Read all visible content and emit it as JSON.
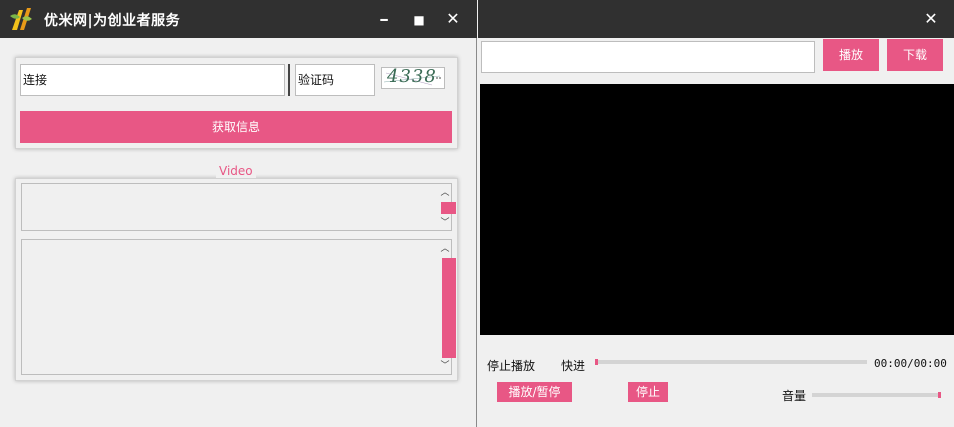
{
  "left_window": {
    "title": "优米网|为创业者服务",
    "controls": {
      "minimize": "━",
      "maximize": "■",
      "close": "✕"
    },
    "link_input_value": "连接",
    "captcha_input_value": "验证码",
    "captcha_text": "4338",
    "get_info_button": "获取信息",
    "video_group_label": "Video"
  },
  "right_window": {
    "controls": {
      "close": "✕"
    },
    "url_input_value": "",
    "play_button": "播放",
    "download_button": "下载",
    "status_text": "停止播放",
    "fast_forward_label": "快进",
    "time_display": "00:00/00:00",
    "play_pause_button": "播放/暂停",
    "stop_button": "停止",
    "volume_label": "音量"
  },
  "colors": {
    "accent": "#e85785",
    "titlebar": "#303030",
    "video_bg": "#000000"
  }
}
